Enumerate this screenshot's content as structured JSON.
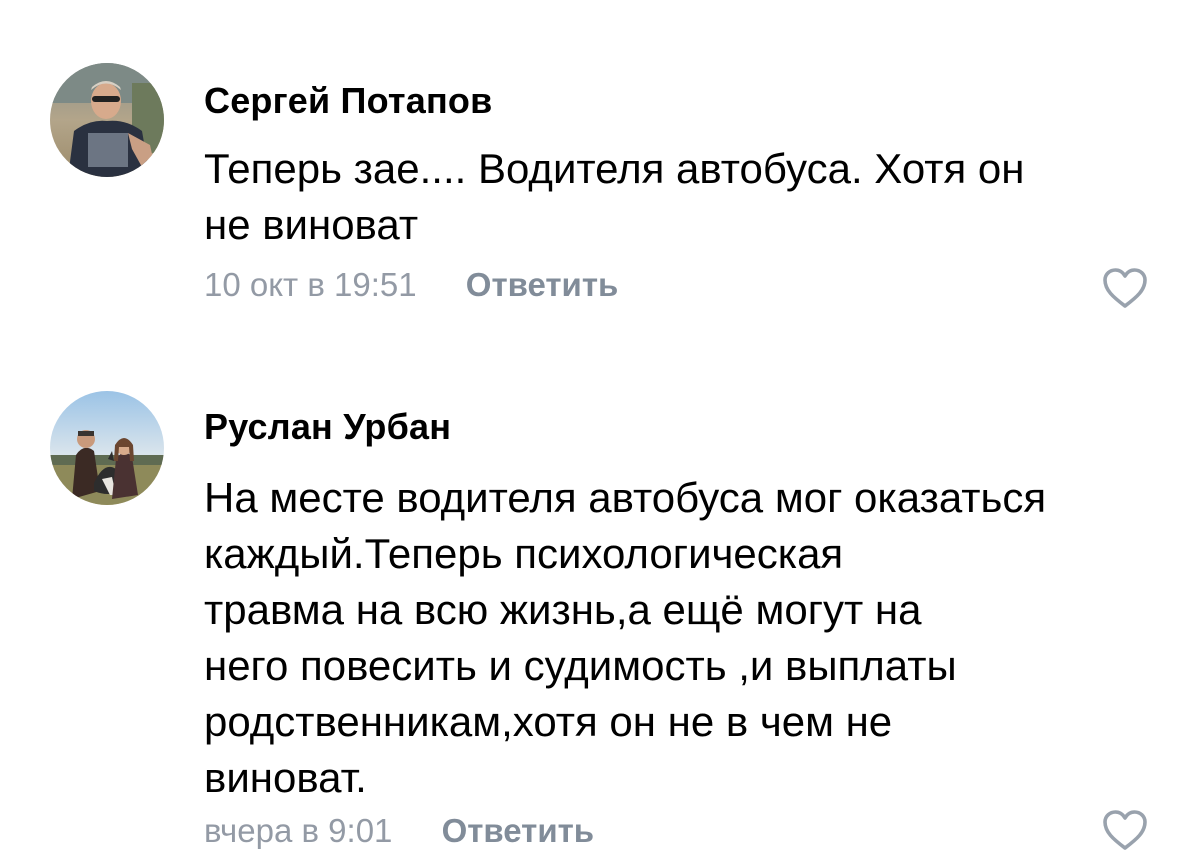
{
  "comments": [
    {
      "author": "Сергей Потапов",
      "text_lines": [
        "Теперь зае.... Водителя автобуса. Хотя он",
        "не виноват"
      ],
      "date": "10 окт в 19:51",
      "reply_label": "Ответить",
      "like_icon": "heart-outline-icon"
    },
    {
      "author": "Руслан Урбан",
      "text_lines": [
        "На месте водителя автобуса мог оказаться",
        "каждый.Теперь психологическая",
        "травма на всю жизнь,а ещё могут на",
        "него повесить и судимость ,и выплаты",
        "родственникам,хотя он не в чем не",
        "виноват."
      ],
      "date": "вчера в 9:01",
      "reply_label": "Ответить",
      "like_icon": "heart-outline-icon"
    }
  ],
  "colors": {
    "meta_text": "#8a939e",
    "like_icon": "#99a2ad",
    "author_text": "#000000"
  }
}
